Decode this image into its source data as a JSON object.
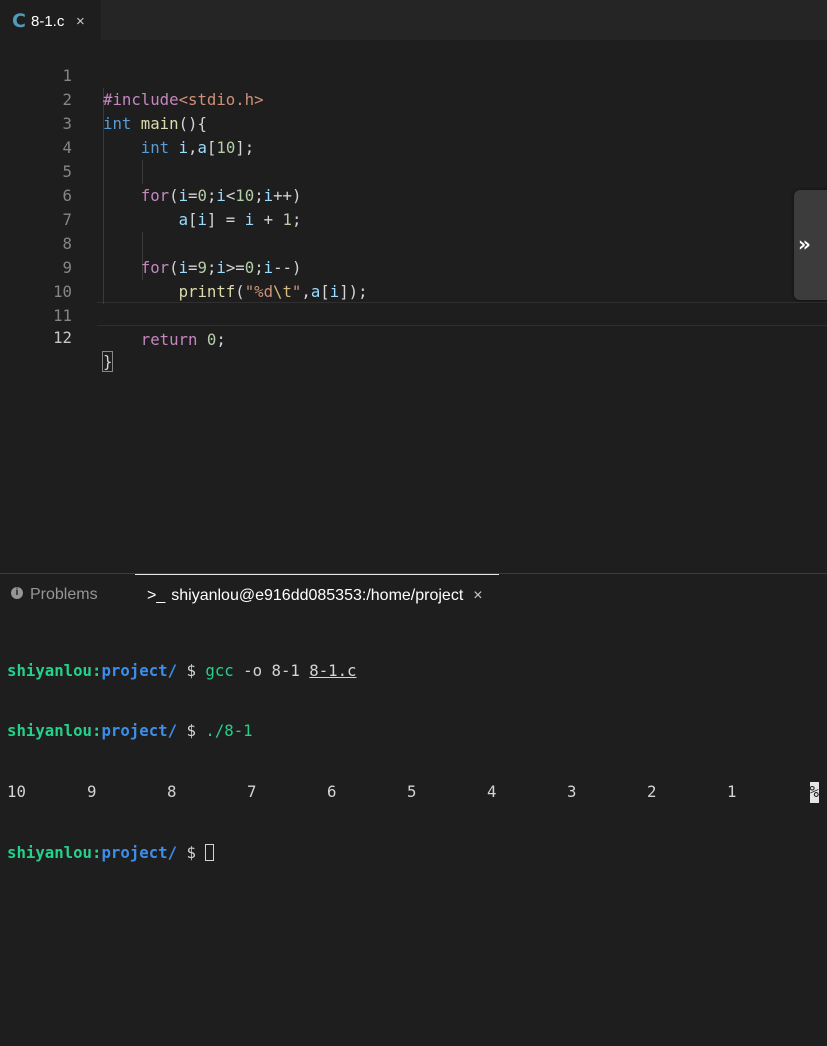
{
  "tab": {
    "icon": "C",
    "label": "8-1.c",
    "close": "×"
  },
  "editor": {
    "line_numbers": [
      "1",
      "2",
      "3",
      "4",
      "5",
      "6",
      "7",
      "8",
      "9",
      "10",
      "11",
      "12"
    ],
    "active_line": "12"
  },
  "code": {
    "l1": {
      "pre": "#include",
      "inc": "<stdio.h>"
    },
    "l2": {
      "kw": "int",
      "fn": "main",
      "p1": "()",
      "brace": "{"
    },
    "l3": {
      "kw": "int",
      "v1": " i",
      "p1": ",",
      "v2": "a",
      "p2": "[",
      "num": "10",
      "p3": "];"
    },
    "l5": {
      "ctl": "for",
      "p1": "(",
      "v1": "i",
      "p2": "=",
      "n1": "0",
      "p3": ";",
      "v2": "i",
      "p4": "<",
      "n2": "10",
      "p5": ";",
      "v3": "i",
      "p6": "++)"
    },
    "l6": {
      "v1": "a",
      "p1": "[",
      "v2": "i",
      "p2": "] = ",
      "v3": "i",
      "p3": " + ",
      "num": "1",
      "p4": ";"
    },
    "l8": {
      "ctl": "for",
      "p1": "(",
      "v1": "i",
      "p2": "=",
      "n1": "9",
      "p3": ";",
      "v2": "i",
      "p4": ">=",
      "n2": "0",
      "p5": ";",
      "v3": "i",
      "p6": "--)"
    },
    "l9": {
      "fn": "printf",
      "p1": "(",
      "s1": "\"%d",
      "esc": "\\t",
      "s2": "\"",
      "p2": ",",
      "v1": "a",
      "p3": "[",
      "v2": "i",
      "p4": "]);"
    },
    "l11": {
      "ctl": "return",
      "num": " 0",
      "p1": ";"
    },
    "l12": {
      "brace": "}"
    }
  },
  "side_toggle": {
    "icon": "»"
  },
  "panel": {
    "problems_label": "Problems",
    "problems_icon": "i",
    "terminal_prompt_icon": ">_",
    "terminal_label": "shiyanlou@e916dd085353:/home/project",
    "terminal_close": "×"
  },
  "terminal": {
    "user": "shiyanlou",
    "colon": ":",
    "dir": "project/",
    "dollar": " $ ",
    "cmd1_prog": "gcc",
    "cmd1_args": " -o 8-1 ",
    "cmd1_file": "8-1.c",
    "cmd2": "./8-1",
    "output": [
      "10",
      "9",
      "8",
      "7",
      "6",
      "5",
      "4",
      "3",
      "2",
      "1"
    ],
    "percent": "%"
  },
  "colors": {
    "background": "#1e1e1e",
    "accent_green": "#23d18b",
    "accent_blue": "#3b8eea"
  }
}
